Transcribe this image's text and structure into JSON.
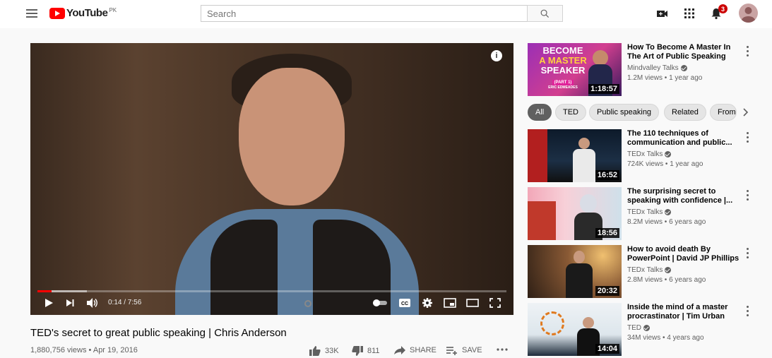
{
  "header": {
    "logo_text": "YouTube",
    "country_code": "PK",
    "search_placeholder": "Search",
    "notification_count": "3"
  },
  "player": {
    "current_time": "0:14 / 7:56",
    "progress_fraction": 0.03,
    "buffered_fraction": 0.105
  },
  "video": {
    "title": "TED's secret to great public speaking | Chris Anderson",
    "meta": "1,880,756 views • Apr 19, 2016",
    "likes": "33K",
    "dislikes": "811",
    "share_label": "SHARE",
    "save_label": "SAVE"
  },
  "sidebar": {
    "top_item": {
      "title": "How To Become A Master In The Art of Public Speaking (Pa...",
      "channel": "Mindvalley Talks",
      "stats": "1.2M views • 1 year ago",
      "duration": "1:18:57",
      "thumb_text": [
        "BECOME",
        "A MASTER",
        "SPEAKER",
        "(PART 1)",
        "ERIC EDMEADES"
      ]
    },
    "chips": [
      "All",
      "TED",
      "Public speaking",
      "Related",
      "From"
    ],
    "items": [
      {
        "title": "The 110 techniques of communication and public...",
        "channel": "TEDx Talks",
        "stats": "724K views • 1 year ago",
        "duration": "16:52"
      },
      {
        "title": "The surprising secret to speaking with confidence |...",
        "channel": "TEDx Talks",
        "stats": "8.2M views • 6 years ago",
        "duration": "18:56"
      },
      {
        "title": "How to avoid death By PowerPoint | David JP Phillips ...",
        "channel": "TEDx Talks",
        "stats": "2.8M views • 6 years ago",
        "duration": "20:32"
      },
      {
        "title": "Inside the mind of a master procrastinator | Tim Urban",
        "channel": "TED",
        "stats": "34M views • 4 years ago",
        "duration": "14:04"
      }
    ]
  },
  "colors": {
    "brand_red": "#ff0000",
    "text_secondary": "#606060",
    "badge_red": "#cc0000"
  }
}
